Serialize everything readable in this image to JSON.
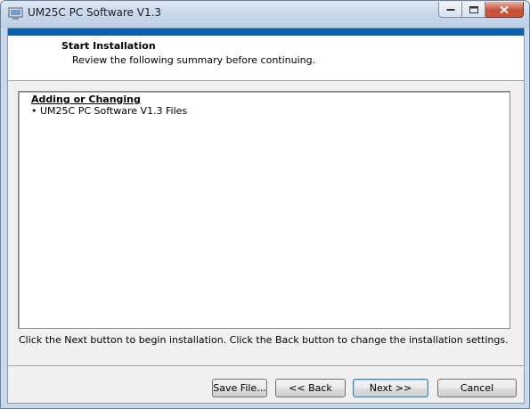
{
  "window": {
    "title": "UM25C PC Software V1.3",
    "buttons": {
      "minimize": "minimize-icon",
      "maximize": "maximize-icon",
      "close": "close-icon"
    }
  },
  "header": {
    "title": "Start Installation",
    "subtitle": "Review the following summary before continuing."
  },
  "summary": {
    "heading": "Adding or Changing",
    "items": [
      "• UM25C PC Software V1.3 Files"
    ]
  },
  "instruction": "Click the Next button to begin installation.  Click the Back button to change the installation settings.",
  "buttons": {
    "save_file": "Save File...",
    "back": "<< Back",
    "next": "Next >>",
    "cancel": "Cancel"
  },
  "colors": {
    "accent_bar": "#0b5fab",
    "title_bar": "#c7d8ec"
  }
}
